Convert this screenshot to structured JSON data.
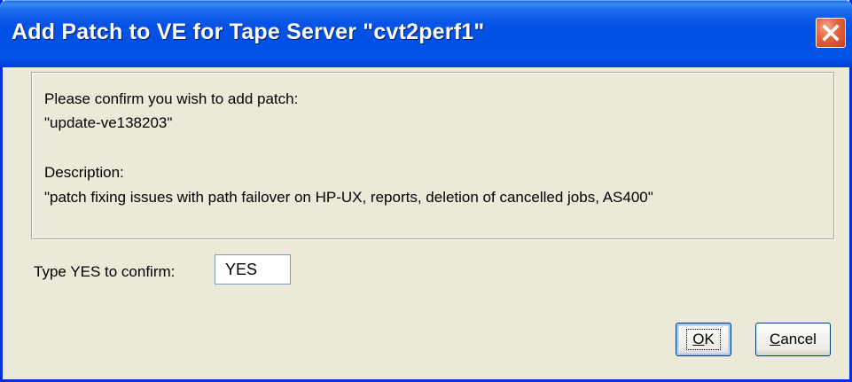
{
  "window": {
    "title": "Add Patch to VE for Tape Server \"cvt2perf1\"",
    "close_icon": "close-x-icon"
  },
  "message": {
    "line1": "Please confirm you wish to add patch:",
    "patch_name": "\"update-ve138203\"",
    "description_label": "Description:",
    "description_text": "\"patch fixing issues with path failover on HP-UX, reports, deletion of cancelled jobs, AS400\""
  },
  "confirm": {
    "label": "Type YES to confirm:",
    "value": "YES"
  },
  "buttons": {
    "ok_mnemonic": "O",
    "ok_rest": "K",
    "cancel_mnemonic": "C",
    "cancel_rest": "ancel"
  },
  "colors": {
    "titlebar": "#0054e3",
    "close_button": "#e2623c",
    "dialog_background": "#ece9d8"
  }
}
